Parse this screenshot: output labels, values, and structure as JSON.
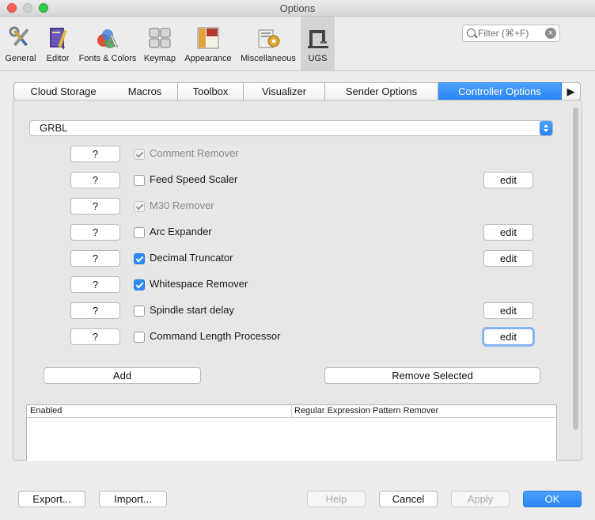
{
  "window": {
    "title": "Options"
  },
  "toolbar": {
    "categories": [
      {
        "label": "General",
        "icon": "wrench-screwdriver-icon"
      },
      {
        "label": "Editor",
        "icon": "book-pen-icon"
      },
      {
        "label": "Fonts & Colors",
        "icon": "fonts-colors-icon"
      },
      {
        "label": "Keymap",
        "icon": "keyboard-icon"
      },
      {
        "label": "Appearance",
        "icon": "layout-icon"
      },
      {
        "label": "Miscellaneous",
        "icon": "misc-gear-icon"
      },
      {
        "label": "UGS",
        "icon": "ugs-machine-icon",
        "selected": true
      }
    ],
    "filter_placeholder": "Filter (⌘+F)"
  },
  "tabs": [
    {
      "label": "Cloud Storage"
    },
    {
      "label": "Macros"
    },
    {
      "label": "Toolbox"
    },
    {
      "label": "Visualizer"
    },
    {
      "label": "Sender Options"
    },
    {
      "label": "Controller Options",
      "selected": true
    }
  ],
  "tabs_more": "▶",
  "controller": {
    "selected": "GRBL"
  },
  "processors": [
    {
      "help": "?",
      "label": "Comment Remover",
      "checked": true,
      "enabled": false,
      "edit": false
    },
    {
      "help": "?",
      "label": "Feed Speed Scaler",
      "checked": false,
      "enabled": true,
      "edit": true
    },
    {
      "help": "?",
      "label": "M30 Remover",
      "checked": true,
      "enabled": false,
      "edit": false
    },
    {
      "help": "?",
      "label": "Arc Expander",
      "checked": false,
      "enabled": true,
      "edit": true
    },
    {
      "help": "?",
      "label": "Decimal Truncator",
      "checked": true,
      "enabled": true,
      "edit": true
    },
    {
      "help": "?",
      "label": "Whitespace Remover",
      "checked": true,
      "enabled": true,
      "edit": false
    },
    {
      "help": "?",
      "label": "Spindle start delay",
      "checked": false,
      "enabled": true,
      "edit": true
    },
    {
      "help": "?",
      "label": "Command Length Processor",
      "checked": false,
      "enabled": true,
      "edit": true
    }
  ],
  "edit_label": "edit",
  "actions": {
    "add": "Add",
    "remove": "Remove Selected"
  },
  "table": {
    "columns": [
      "Enabled",
      "Regular Expression Pattern Remover"
    ]
  },
  "footer": {
    "export": "Export...",
    "import": "Import...",
    "help": "Help",
    "cancel": "Cancel",
    "apply": "Apply",
    "ok": "OK"
  },
  "colors": {
    "accent": "#2a84f5",
    "selected_category": "#d3d3d3",
    "close": "#fc5f57",
    "maximize": "#34c84a"
  }
}
